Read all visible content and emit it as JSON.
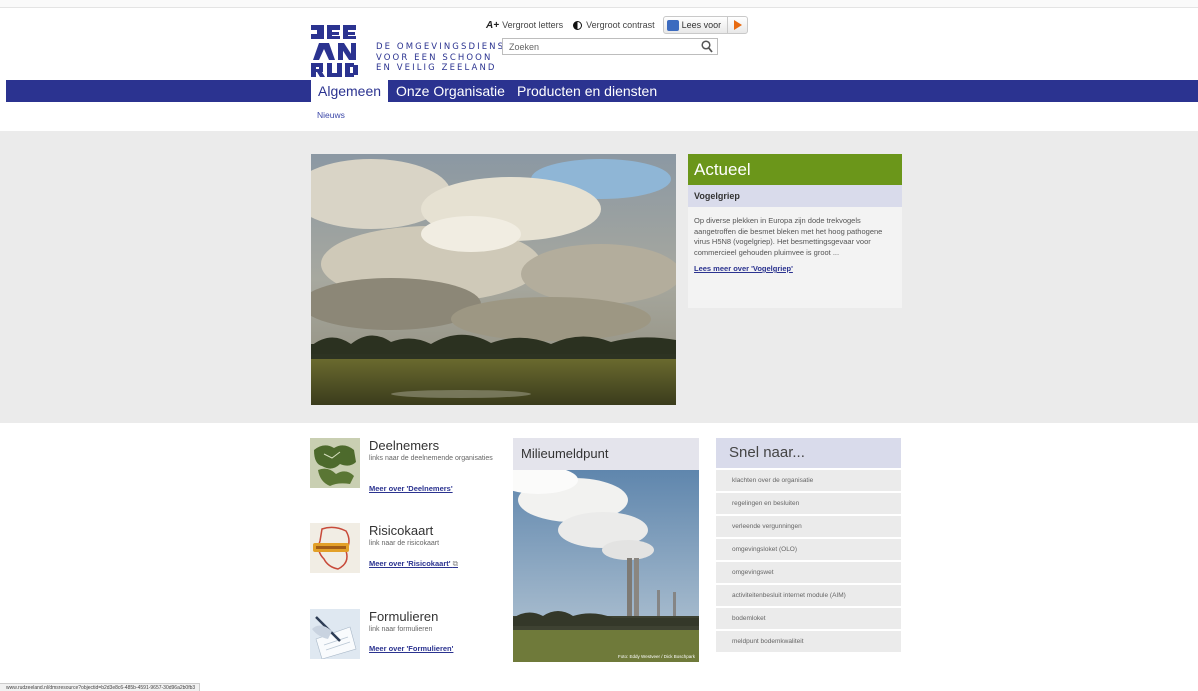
{
  "header": {
    "logo_lines": [
      "DE OMGEVINGSDIENST",
      "VOOR EEN SCHOON",
      "EN VEILIG ZEELAND"
    ],
    "access": {
      "bigger_text": "Vergroot letters",
      "contrast": "Vergroot contrast",
      "read_aloud": "Lees voor"
    },
    "search_placeholder": "Zoeken"
  },
  "nav": {
    "items": [
      "Algemeen",
      "Onze Organisatie",
      "Producten en diensten"
    ],
    "active": "Algemeen",
    "subnav": "Nieuws"
  },
  "actueel": {
    "heading": "Actueel",
    "subheading": "Vogelgriep",
    "body": "Op diverse plekken in Europa zijn dode trekvogels aangetroffen die besmet bleken met het hoog pathogene virus H5N8 (vogelgriep). Het besmettingsgevaar voor commercieel gehouden pluimvee is groot ...",
    "link": "Lees meer over 'Vogelgriep'"
  },
  "items": [
    {
      "title": "Deelnemers",
      "desc": "links naar de deelnemende organisaties",
      "more": "Meer over 'Deelnemers'"
    },
    {
      "title": "Risicokaart",
      "desc": "link naar de risicokaart",
      "more": "Meer over 'Risicokaart'"
    },
    {
      "title": "Formulieren",
      "desc": "link naar formulieren",
      "more": "Meer over 'Formulieren'"
    }
  ],
  "milieu": {
    "heading": "Milieumeldpunt",
    "credit": "Foto: Eddy Westveer / Dick Boschpark"
  },
  "snel": {
    "heading": "Snel naar...",
    "links": [
      "klachten over de organisatie",
      "regelingen en besluiten",
      "verleende vergunningen",
      "omgevingsloket (OLO)",
      "omgevingswet",
      "activiteitenbesluit internet module (AIM)",
      "bodemloket",
      "meldpunt bodemkwaliteit"
    ]
  },
  "status_url": "www.rudzeeland.nl/dmsresource?objectid=b2d3e8c6-485b-4591-9657-30d96a2b0fb3",
  "colors": {
    "brand": "#2b3390",
    "green": "#6b961a",
    "lavender": "#d9dbeb",
    "band": "#ebebeb"
  }
}
